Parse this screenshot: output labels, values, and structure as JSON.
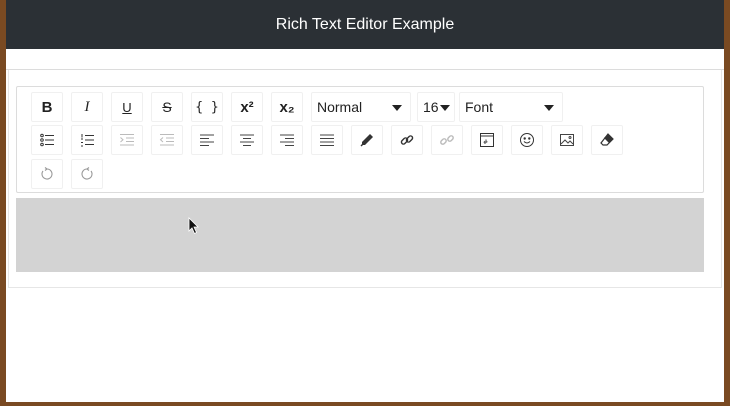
{
  "window": {
    "title": "Rich Text Editor Example"
  },
  "toolbar": {
    "bold_label": "B",
    "italic_label": "I",
    "underline_label": "U",
    "strikethrough_label": "S",
    "code_label": "{ }",
    "superscript_label": "x²",
    "subscript_label": "x₂",
    "block_type": "Normal",
    "font_size": "16",
    "font_family": "Font"
  },
  "icons": [
    "unordered-list-icon",
    "ordered-list-icon",
    "indent-icon",
    "outdent-icon",
    "align-left-icon",
    "align-center-icon",
    "align-right-icon",
    "align-justify-icon",
    "color-picker-icon",
    "link-icon",
    "unlink-icon",
    "embedded-icon",
    "emoji-icon",
    "image-icon",
    "eraser-icon",
    "undo-icon",
    "redo-icon"
  ],
  "colors": {
    "titlebar": "#2b3035",
    "editor_area": "#d3d3d3",
    "desktop": "#7a4a22"
  }
}
